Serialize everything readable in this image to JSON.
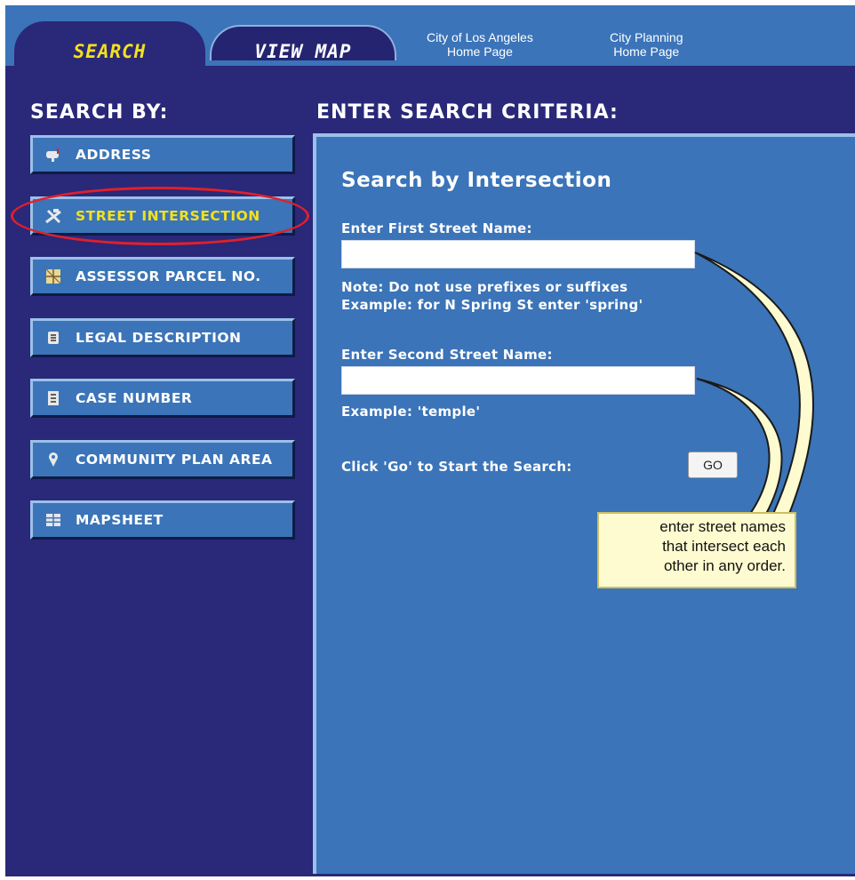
{
  "tabs": {
    "search": "SEARCH",
    "view_map": "VIEW MAP"
  },
  "top_links": {
    "city_line1": "City of Los Angeles",
    "city_line2": "Home Page",
    "planning_line1": "City Planning",
    "planning_line2": "Home Page"
  },
  "headers": {
    "search_by": "SEARCH BY:",
    "criteria": "ENTER SEARCH CRITERIA:"
  },
  "nav": {
    "items": [
      {
        "label": "ADDRESS",
        "icon": "mailbox-icon"
      },
      {
        "label": "STREET INTERSECTION",
        "icon": "intersection-icon",
        "active": true
      },
      {
        "label": "ASSESSOR PARCEL NO.",
        "icon": "parcel-icon"
      },
      {
        "label": "LEGAL DESCRIPTION",
        "icon": "scroll-icon"
      },
      {
        "label": "CASE NUMBER",
        "icon": "document-icon"
      },
      {
        "label": "COMMUNITY PLAN AREA",
        "icon": "map-pin-icon"
      },
      {
        "label": "MAPSHEET",
        "icon": "grid-icon"
      }
    ]
  },
  "form": {
    "title": "Search by Intersection",
    "first_label": "Enter First Street Name:",
    "first_value": "",
    "note_line1": "Note: Do not use prefixes or suffixes",
    "note_line2": "Example: for N Spring St enter 'spring'",
    "second_label": "Enter Second Street Name:",
    "second_value": "",
    "second_example": "Example: 'temple'",
    "go_prompt": "Click 'Go' to Start the Search:",
    "go_button": "GO"
  },
  "tooltip": {
    "line1": "enter street names",
    "line2": "that intersect each",
    "line3": "other in any order."
  },
  "colors": {
    "navy": "#2a2879",
    "panel_blue": "#3b74b8",
    "active_yellow": "#f3e11d",
    "highlight_red": "#e0202a",
    "tooltip_bg": "#fffbd0"
  }
}
